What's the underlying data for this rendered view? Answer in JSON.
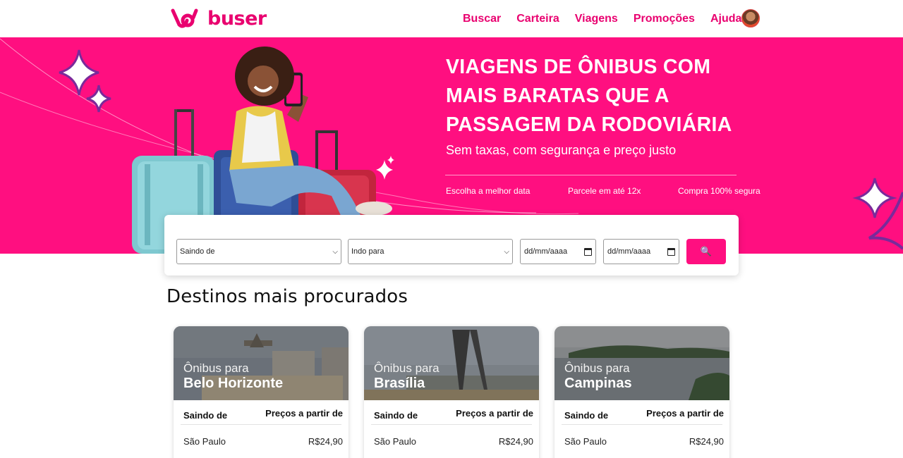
{
  "brand": {
    "name": "buser",
    "color": "#e9006f",
    "hero_bg": "#ff0f80"
  },
  "nav": {
    "items": [
      "Buscar",
      "Carteira",
      "Viagens",
      "Promoções",
      "Ajuda"
    ]
  },
  "hero": {
    "title_lines": [
      "VIAGENS DE ÔNIBUS COM",
      "MAIS BARATAS QUE A",
      "PASSAGEM DA RODOVIÁRIA"
    ],
    "subtitle": "Sem taxas, com segurança e preço justo",
    "features": [
      "Escolha a melhor data",
      "Parcele em até 12x",
      "Compra 100% segura"
    ]
  },
  "search": {
    "origin": "Saindo de",
    "destination": "Indo para",
    "date_from": "dd/mm/aaaa",
    "date_to": "dd/mm/aaaa",
    "button_icon": "search-icon",
    "button_glyph": "🔍"
  },
  "section": {
    "title": "Destinos mais procurados"
  },
  "destinations": [
    {
      "pre": "Ônibus para",
      "city": "Belo Horizonte",
      "from_label": "Saindo de",
      "price_label": "Preços a partir de",
      "from": "São Paulo",
      "price": "R$24,90"
    },
    {
      "pre": "Ônibus para",
      "city": "Brasília",
      "from_label": "Saindo de",
      "price_label": "Preços a partir de",
      "from": "São Paulo",
      "price": "R$24,90"
    },
    {
      "pre": "Ônibus para",
      "city": "Campinas",
      "from_label": "Saindo de",
      "price_label": "Preços a partir de",
      "from": "São Paulo",
      "price": "R$24,90"
    }
  ]
}
